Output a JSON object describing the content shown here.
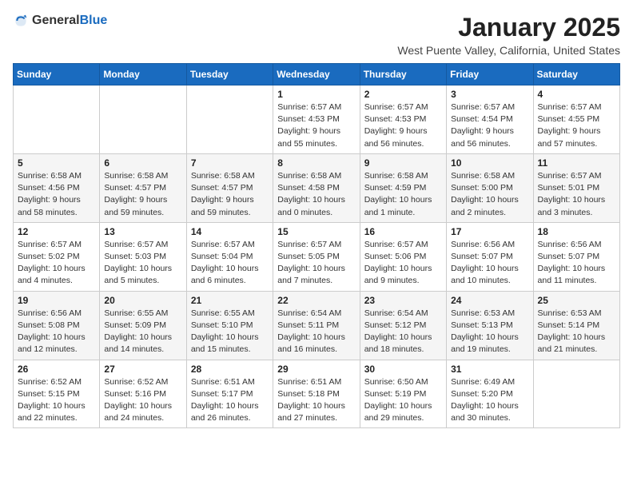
{
  "header": {
    "logo_general": "General",
    "logo_blue": "Blue",
    "month": "January 2025",
    "location": "West Puente Valley, California, United States"
  },
  "days_of_week": [
    "Sunday",
    "Monday",
    "Tuesday",
    "Wednesday",
    "Thursday",
    "Friday",
    "Saturday"
  ],
  "weeks": [
    [
      {
        "day": "",
        "info": ""
      },
      {
        "day": "",
        "info": ""
      },
      {
        "day": "",
        "info": ""
      },
      {
        "day": "1",
        "info": "Sunrise: 6:57 AM\nSunset: 4:53 PM\nDaylight: 9 hours and 55 minutes."
      },
      {
        "day": "2",
        "info": "Sunrise: 6:57 AM\nSunset: 4:53 PM\nDaylight: 9 hours and 56 minutes."
      },
      {
        "day": "3",
        "info": "Sunrise: 6:57 AM\nSunset: 4:54 PM\nDaylight: 9 hours and 56 minutes."
      },
      {
        "day": "4",
        "info": "Sunrise: 6:57 AM\nSunset: 4:55 PM\nDaylight: 9 hours and 57 minutes."
      }
    ],
    [
      {
        "day": "5",
        "info": "Sunrise: 6:58 AM\nSunset: 4:56 PM\nDaylight: 9 hours and 58 minutes."
      },
      {
        "day": "6",
        "info": "Sunrise: 6:58 AM\nSunset: 4:57 PM\nDaylight: 9 hours and 59 minutes."
      },
      {
        "day": "7",
        "info": "Sunrise: 6:58 AM\nSunset: 4:57 PM\nDaylight: 9 hours and 59 minutes."
      },
      {
        "day": "8",
        "info": "Sunrise: 6:58 AM\nSunset: 4:58 PM\nDaylight: 10 hours and 0 minutes."
      },
      {
        "day": "9",
        "info": "Sunrise: 6:58 AM\nSunset: 4:59 PM\nDaylight: 10 hours and 1 minute."
      },
      {
        "day": "10",
        "info": "Sunrise: 6:58 AM\nSunset: 5:00 PM\nDaylight: 10 hours and 2 minutes."
      },
      {
        "day": "11",
        "info": "Sunrise: 6:57 AM\nSunset: 5:01 PM\nDaylight: 10 hours and 3 minutes."
      }
    ],
    [
      {
        "day": "12",
        "info": "Sunrise: 6:57 AM\nSunset: 5:02 PM\nDaylight: 10 hours and 4 minutes."
      },
      {
        "day": "13",
        "info": "Sunrise: 6:57 AM\nSunset: 5:03 PM\nDaylight: 10 hours and 5 minutes."
      },
      {
        "day": "14",
        "info": "Sunrise: 6:57 AM\nSunset: 5:04 PM\nDaylight: 10 hours and 6 minutes."
      },
      {
        "day": "15",
        "info": "Sunrise: 6:57 AM\nSunset: 5:05 PM\nDaylight: 10 hours and 7 minutes."
      },
      {
        "day": "16",
        "info": "Sunrise: 6:57 AM\nSunset: 5:06 PM\nDaylight: 10 hours and 9 minutes."
      },
      {
        "day": "17",
        "info": "Sunrise: 6:56 AM\nSunset: 5:07 PM\nDaylight: 10 hours and 10 minutes."
      },
      {
        "day": "18",
        "info": "Sunrise: 6:56 AM\nSunset: 5:07 PM\nDaylight: 10 hours and 11 minutes."
      }
    ],
    [
      {
        "day": "19",
        "info": "Sunrise: 6:56 AM\nSunset: 5:08 PM\nDaylight: 10 hours and 12 minutes."
      },
      {
        "day": "20",
        "info": "Sunrise: 6:55 AM\nSunset: 5:09 PM\nDaylight: 10 hours and 14 minutes."
      },
      {
        "day": "21",
        "info": "Sunrise: 6:55 AM\nSunset: 5:10 PM\nDaylight: 10 hours and 15 minutes."
      },
      {
        "day": "22",
        "info": "Sunrise: 6:54 AM\nSunset: 5:11 PM\nDaylight: 10 hours and 16 minutes."
      },
      {
        "day": "23",
        "info": "Sunrise: 6:54 AM\nSunset: 5:12 PM\nDaylight: 10 hours and 18 minutes."
      },
      {
        "day": "24",
        "info": "Sunrise: 6:53 AM\nSunset: 5:13 PM\nDaylight: 10 hours and 19 minutes."
      },
      {
        "day": "25",
        "info": "Sunrise: 6:53 AM\nSunset: 5:14 PM\nDaylight: 10 hours and 21 minutes."
      }
    ],
    [
      {
        "day": "26",
        "info": "Sunrise: 6:52 AM\nSunset: 5:15 PM\nDaylight: 10 hours and 22 minutes."
      },
      {
        "day": "27",
        "info": "Sunrise: 6:52 AM\nSunset: 5:16 PM\nDaylight: 10 hours and 24 minutes."
      },
      {
        "day": "28",
        "info": "Sunrise: 6:51 AM\nSunset: 5:17 PM\nDaylight: 10 hours and 26 minutes."
      },
      {
        "day": "29",
        "info": "Sunrise: 6:51 AM\nSunset: 5:18 PM\nDaylight: 10 hours and 27 minutes."
      },
      {
        "day": "30",
        "info": "Sunrise: 6:50 AM\nSunset: 5:19 PM\nDaylight: 10 hours and 29 minutes."
      },
      {
        "day": "31",
        "info": "Sunrise: 6:49 AM\nSunset: 5:20 PM\nDaylight: 10 hours and 30 minutes."
      },
      {
        "day": "",
        "info": ""
      }
    ]
  ]
}
